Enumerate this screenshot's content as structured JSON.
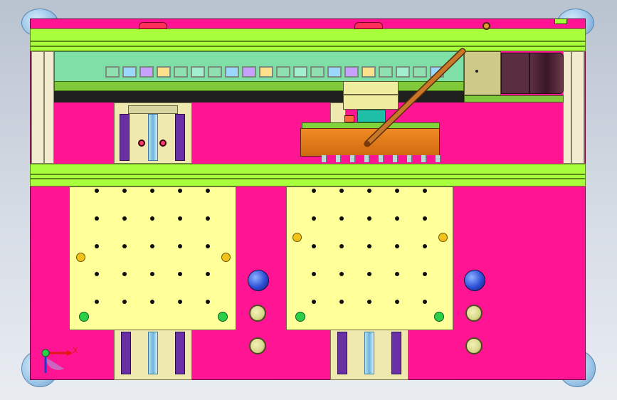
{
  "scene": {
    "description_text": "",
    "axis_triad": {
      "x_label": "X"
    },
    "colors": {
      "base": "#ff1493",
      "rail": "#a8ff3c",
      "plate": "#ffff9a",
      "chain": "#8fe0b0",
      "carriage": "#e07a1a",
      "arm": "#b5651d",
      "motor": "#5a2d3f",
      "foot": "#9fc8ea"
    },
    "icons": [
      "foot-pad",
      "screw-head",
      "knob",
      "axis-triad"
    ]
  }
}
